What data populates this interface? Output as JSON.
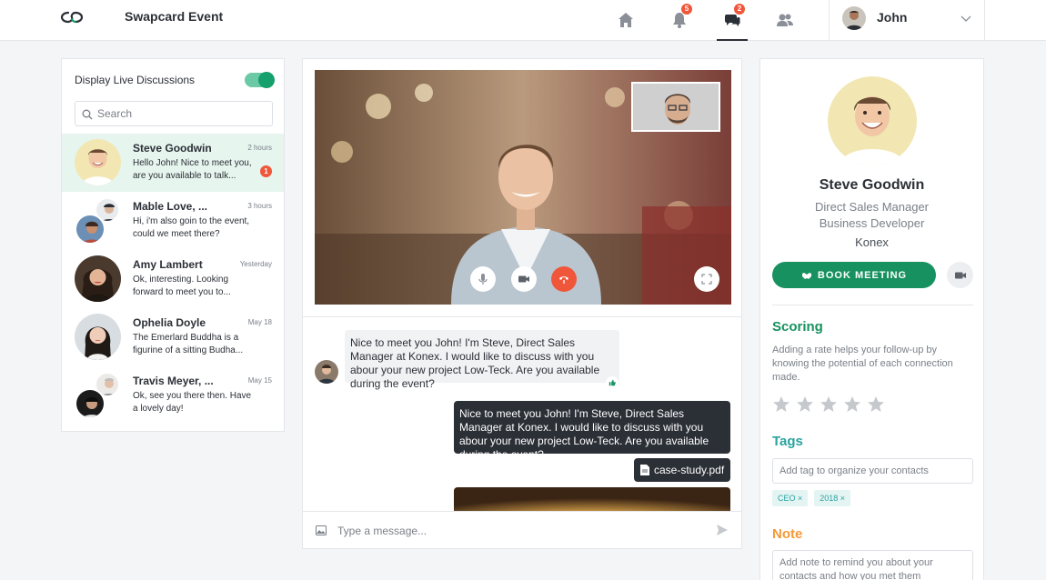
{
  "header": {
    "app_title": "Swapcard Event",
    "notifications_badge": "5",
    "messages_badge": "2",
    "user_name": "John"
  },
  "sidebar": {
    "live_label": "Display Live Discussions",
    "search_placeholder": "Search",
    "conversations": [
      {
        "name": "Steve Goodwin",
        "time": "2 hours",
        "preview": "Hello John! Nice to meet you, are you available to talk...",
        "unread": "1"
      },
      {
        "name": "Mable Love, ...",
        "time": "3 hours",
        "preview": "Hi, i'm also goin to the event, could we meet there?"
      },
      {
        "name": "Amy Lambert",
        "time": "Yesterday",
        "preview": "Ok, interesting. Looking forward to meet you to..."
      },
      {
        "name": "Ophelia Doyle",
        "time": "May 18",
        "preview": "The Emerlard Buddha is a figurine of a sitting Budha..."
      },
      {
        "name": "Travis Meyer, ...",
        "time": "May 15",
        "preview": "Ok, see you there then. Have a lovely day!"
      }
    ]
  },
  "chat": {
    "incoming_message": "Nice to meet you John! I'm Steve, Direct Sales Manager at Konex. I would like to discuss with you abour your new project Low-Teck. Are you available during the event?",
    "outgoing_message": "Nice to meet you John! I'm Steve, Direct Sales Manager at Konex. I would like to discuss with you abour your new project Low-Teck. Are you available during the event?",
    "attachment_name": "case-study.pdf",
    "composer_placeholder": "Type a message..."
  },
  "profile": {
    "name": "Steve Goodwin",
    "role_1": "Direct Sales Manager",
    "role_2": "Business Developer",
    "company": "Konex",
    "book_button": "BOOK MEETING",
    "scoring_title": "Scoring",
    "scoring_desc": "Adding a rate helps your follow-up by knowing the potential of each connection made.",
    "stars_filled": 0,
    "stars_total": 5,
    "tags_title": "Tags",
    "tag_placeholder": "Add tag to organize your contacts",
    "tags": [
      "CEO ×",
      "2018 ×"
    ],
    "note_title": "Note",
    "note_placeholder": "Add note to remind you about your contacts and how you met them"
  },
  "colors": {
    "brand_green": "#17915f",
    "badge_red": "#f0563a",
    "tags_teal": "#2aa3a0",
    "note_orange": "#f39a3a"
  }
}
